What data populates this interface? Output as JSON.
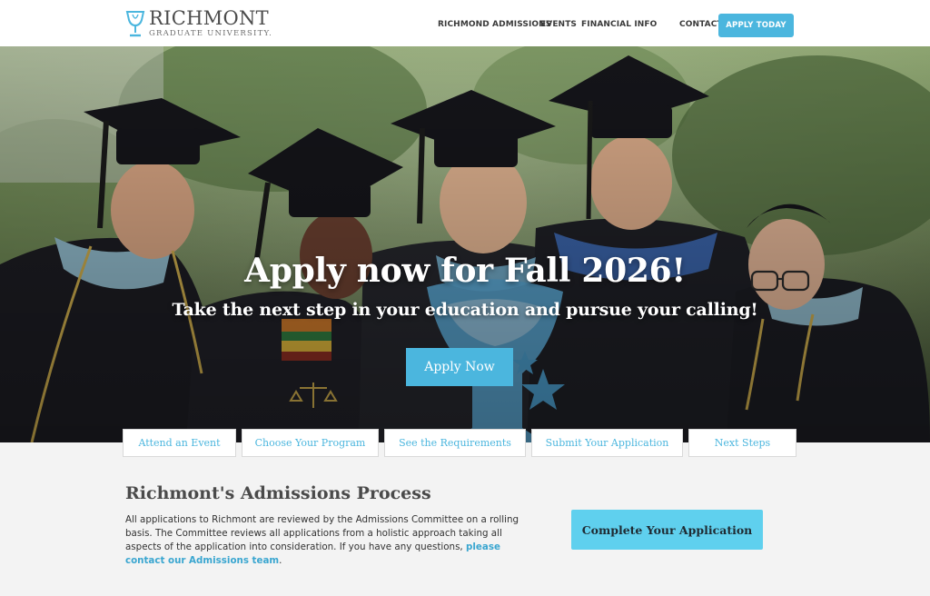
{
  "header": {
    "logo_name": "RICHMONT",
    "logo_sub": "GRADUATE UNIVERSITY.",
    "nav": [
      "RICHMOND ADMISSIONS",
      "EVENTS",
      "FINANCIAL INFO",
      "CONTACT US"
    ],
    "cta": "APPLY TODAY"
  },
  "hero": {
    "title": "Apply now for Fall 2026!",
    "subtitle": "Take the next step in your education and pursue your calling!",
    "button": "Apply Now"
  },
  "steps": [
    "Attend an Event",
    "Choose Your Program",
    "See the Requirements",
    "Submit Your Application",
    "Next Steps"
  ],
  "process": {
    "title": "Richmont's Admissions Process",
    "text": "All applications to Richmont are reviewed by the Admissions Committee on a rolling basis. The Committee reviews all applications from a holistic approach taking all aspects of the application into consideration. If you have any questions, ",
    "link": "please contact our Admissions team",
    "end": ".",
    "button": "Complete Your Application"
  },
  "colors": {
    "accent": "#4bb6de",
    "accent_light": "#5fd0ee",
    "background": "#f3f3f3"
  }
}
